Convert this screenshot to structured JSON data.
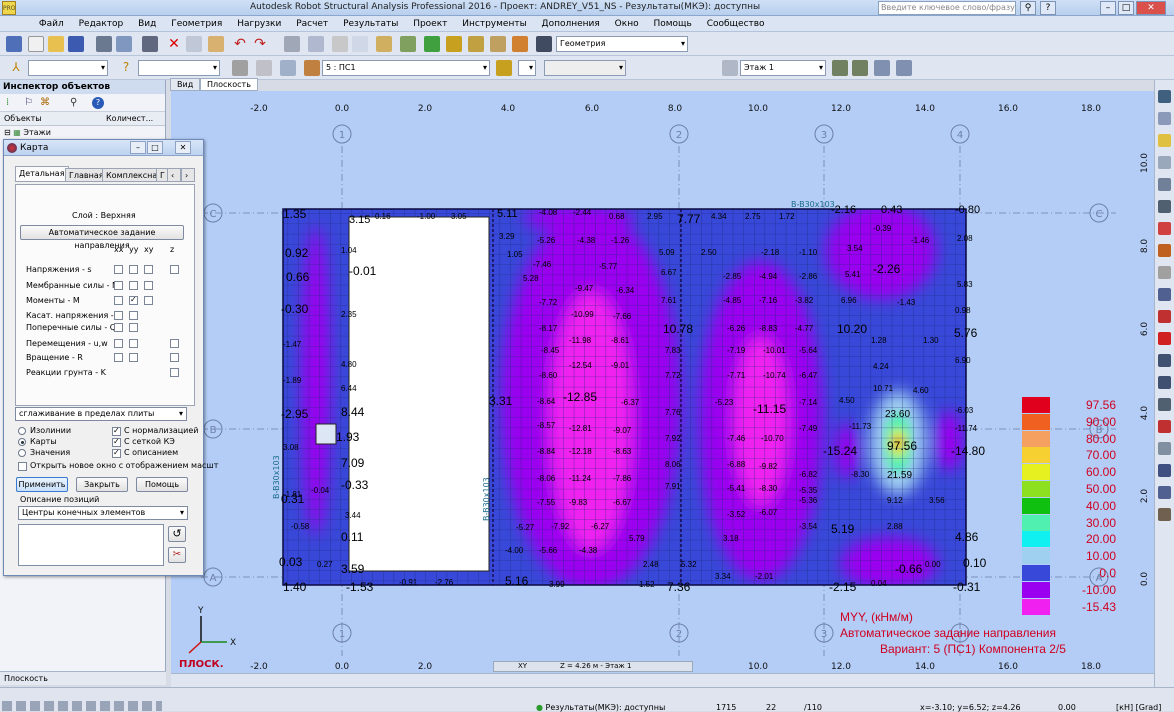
{
  "window": {
    "title": "Autodesk Robot Structural Analysis Professional 2016 - Проект: ANDREY_V51_NS - Результаты(МКЭ): доступны",
    "app_badge": "PRO",
    "search_placeholder": "Введите ключевое слово/фразу"
  },
  "menu": [
    "Файл",
    "Редактор",
    "Вид",
    "Геометрия",
    "Нагрузки",
    "Расчет",
    "Результаты",
    "Проект",
    "Инструменты",
    "Дополнения",
    "Окно",
    "Помощь",
    "Сообщество"
  ],
  "toolbar": {
    "layout_combo": "Геометрия",
    "case_combo": "5 : ПС1",
    "storey_combo": "Этаж 1"
  },
  "inspector": {
    "title": "Инспектор объектов",
    "col_objects": "Объекты",
    "col_count": "Количест...",
    "tree_item": "Этажи",
    "bottom_tab": "Плоскость"
  },
  "view_tabs": [
    "Вид",
    "Плоскость"
  ],
  "dialog": {
    "title": "Карта",
    "tabs": [
      "Детальная",
      "Главная",
      "Комплексная",
      "Г"
    ],
    "layer": "Слой : Верхняя",
    "auto_btn": "Автоматическое задание направления",
    "col_heads": [
      "xx",
      "yy",
      "xy",
      "z"
    ],
    "rows": [
      "Напряжения - s",
      "Мембранные силы - N",
      "Моменты - M",
      "Касат. напряжения - t",
      "Поперечные силы - Q",
      "Перемещения - u,w",
      "Вращение - R",
      "Реакции грунта - K"
    ],
    "smooth": "сглаживание в пределах плиты",
    "opt_isolines": "Изолинии",
    "opt_maps": "Карты",
    "opt_values": "Значения",
    "chk_norm": "С нормализацией",
    "chk_grid": "С сеткой КЭ",
    "chk_desc": "С описанием",
    "chk_newwin": "Открыть новое окно с отображением масшт",
    "btn_apply": "Применить",
    "btn_close": "Закрыть",
    "btn_help": "Помощь",
    "pos_label": "Описание позиций",
    "pos_select": "Центры конечных элементов"
  },
  "legend": {
    "values": [
      "97.56",
      "90.00",
      "80.00",
      "70.00",
      "60.00",
      "50.00",
      "40.00",
      "30.00",
      "20.00",
      "10.00",
      "0.0",
      "-10.00",
      "-15.43"
    ],
    "colors": [
      "#e0001e",
      "#f06020",
      "#f5a060",
      "#f5d030",
      "#e6f020",
      "#8ce020",
      "#10c010",
      "#50f0b0",
      "#10f0f0",
      "#a0d0f0",
      "#3848d8",
      "#9a00ef",
      "#f020f0"
    ]
  },
  "caption": {
    "line1": "MYY, (кНм/м)",
    "line2": "Автоматическое задание направления",
    "line3": "Вариант: 5 (ПС1) Компонента 2/5"
  },
  "axes": {
    "top": [
      "-2.0",
      "0.0",
      "2.0",
      "4.0",
      "6.0",
      "8.0",
      "10.0",
      "12.0",
      "14.0",
      "16.0",
      "18.0"
    ],
    "right": [
      "10.0",
      "8.0",
      "6.0",
      "4.0",
      "2.0",
      "0.0"
    ],
    "grid_cols": [
      "1",
      "2",
      "3",
      "4"
    ],
    "grid_rows": [
      "C",
      "B",
      "A"
    ],
    "view_label": "ПЛОСК.",
    "xy_label": "XY",
    "z_label": "Z = 4.26 м - Этаж 1"
  },
  "values": [
    {
      "t": "1.35"
    },
    {
      "t": "3.15"
    },
    {
      "t": "0.16"
    },
    {
      "t": "-1.00"
    },
    {
      "t": "3.05"
    },
    {
      "t": "5.11"
    },
    {
      "t": "-4.08"
    },
    {
      "t": "-2.44"
    },
    {
      "t": "0.68"
    },
    {
      "t": "2.95"
    },
    {
      "t": "7.77"
    },
    {
      "t": "4.34"
    },
    {
      "t": "2.75"
    },
    {
      "t": "1.72"
    },
    {
      "t": "-2.16"
    },
    {
      "t": "0.43"
    },
    {
      "t": "-0.80"
    },
    {
      "t": "0.92"
    },
    {
      "t": "1.04"
    },
    {
      "t": "3.29"
    },
    {
      "t": "-5.26"
    },
    {
      "t": "-4.38"
    },
    {
      "t": "-1.26"
    },
    {
      "t": "5.09"
    },
    {
      "t": "2.50"
    },
    {
      "t": "-2.18"
    },
    {
      "t": "-1.10"
    },
    {
      "t": "3.54"
    },
    {
      "t": "-0.39"
    },
    {
      "t": "-1.46"
    },
    {
      "t": "2.08"
    },
    {
      "t": "-0.01"
    },
    {
      "t": "0.66"
    },
    {
      "t": "-7.46"
    },
    {
      "t": "-5.77"
    },
    {
      "t": "-2.26"
    },
    {
      "t": "1.05"
    },
    {
      "t": "5.28"
    },
    {
      "t": "6.67"
    },
    {
      "t": "-2.85"
    },
    {
      "t": "-4.94"
    },
    {
      "t": "-2.86"
    },
    {
      "t": "5.41"
    },
    {
      "t": "5.83"
    },
    {
      "t": "-0.30"
    },
    {
      "t": "-9.47"
    },
    {
      "t": "-6.34"
    },
    {
      "t": "-7.72"
    },
    {
      "t": "7.61"
    },
    {
      "t": "-4.85"
    },
    {
      "t": "-7.16"
    },
    {
      "t": "-3.82"
    },
    {
      "t": "6.96"
    },
    {
      "t": "-1.43"
    },
    {
      "t": "0.98"
    },
    {
      "t": "2.35"
    },
    {
      "t": "-10.99"
    },
    {
      "t": "-7.66"
    },
    {
      "t": "-8.17"
    },
    {
      "t": "10.78"
    },
    {
      "t": "-6.26"
    },
    {
      "t": "-8.83"
    },
    {
      "t": "-4.77"
    },
    {
      "t": "10.20"
    },
    {
      "t": "5.76"
    },
    {
      "t": "-1.47"
    },
    {
      "t": "-11.98"
    },
    {
      "t": "-8.61"
    },
    {
      "t": "-8.45"
    },
    {
      "t": "7.83"
    },
    {
      "t": "-7.19"
    },
    {
      "t": "-10.01"
    },
    {
      "t": "-5.64"
    },
    {
      "t": "1.28"
    },
    {
      "t": "1.30"
    },
    {
      "t": "4.80"
    },
    {
      "t": "-1.89"
    },
    {
      "t": "-12.54"
    },
    {
      "t": "-9.01"
    },
    {
      "t": "-8.60"
    },
    {
      "t": "7.72"
    },
    {
      "t": "-7.71"
    },
    {
      "t": "-10.74"
    },
    {
      "t": "-6.47"
    },
    {
      "t": "4.24"
    },
    {
      "t": "6.90"
    },
    {
      "t": "6.44"
    },
    {
      "t": "-12.85"
    },
    {
      "t": "-8.64"
    },
    {
      "t": "-6.37"
    },
    {
      "t": "7.76"
    },
    {
      "t": "-5.23"
    },
    {
      "t": "-11.15"
    },
    {
      "t": "-7.14"
    },
    {
      "t": "4.50"
    },
    {
      "t": "10.71"
    },
    {
      "t": "4.60"
    },
    {
      "t": "-2.95"
    },
    {
      "t": "8.44"
    },
    {
      "t": "3.31"
    },
    {
      "t": "23.60"
    },
    {
      "t": "-6.03"
    },
    {
      "t": "1.93"
    },
    {
      "t": "-8.57"
    },
    {
      "t": "-12.81"
    },
    {
      "t": "-9.07"
    },
    {
      "t": "7.92"
    },
    {
      "t": "-7.46"
    },
    {
      "t": "-10.70"
    },
    {
      "t": "-7.49"
    },
    {
      "t": "-11.73"
    },
    {
      "t": "-11.74"
    },
    {
      "t": "3.08"
    },
    {
      "t": "-8.84"
    },
    {
      "t": "-12.18"
    },
    {
      "t": "-8.63"
    },
    {
      "t": "-15.24"
    },
    {
      "t": "97.56"
    },
    {
      "t": "-14.80"
    },
    {
      "t": "7.09"
    },
    {
      "t": "8.06"
    },
    {
      "t": "-6.88"
    },
    {
      "t": "-9.82"
    },
    {
      "t": "-6.82"
    },
    {
      "t": "-8.30"
    },
    {
      "t": "21.59"
    },
    {
      "t": "-0.33"
    },
    {
      "t": "-1.81"
    },
    {
      "t": "-8.06"
    },
    {
      "t": "-11.24"
    },
    {
      "t": "-7.86"
    },
    {
      "t": "7.91"
    },
    {
      "t": "-5.41"
    },
    {
      "t": "-8.30"
    },
    {
      "t": "-5.35"
    },
    {
      "t": "-0.04"
    },
    {
      "t": "0.31"
    },
    {
      "t": "-7.55"
    },
    {
      "t": "-9.83"
    },
    {
      "t": "-6.67"
    },
    {
      "t": "-3.52"
    },
    {
      "t": "-6.07"
    },
    {
      "t": "-5.36"
    },
    {
      "t": "9.12"
    },
    {
      "t": "3.56"
    },
    {
      "t": "3.44"
    },
    {
      "t": "-5.27"
    },
    {
      "t": "-7.92"
    },
    {
      "t": "-6.27"
    },
    {
      "t": "-3.54"
    },
    {
      "t": "2.88"
    },
    {
      "t": "5.19"
    },
    {
      "t": "-0.58"
    },
    {
      "t": "0.11"
    },
    {
      "t": "-4.00"
    },
    {
      "t": "-5.66"
    },
    {
      "t": "-4.38"
    },
    {
      "t": "5.79"
    },
    {
      "t": "3.18"
    },
    {
      "t": "4.86"
    },
    {
      "t": "0.03"
    },
    {
      "t": "0.27"
    },
    {
      "t": "3.59"
    },
    {
      "t": "2.48"
    },
    {
      "t": "5.32"
    },
    {
      "t": "3.34"
    },
    {
      "t": "-2.01"
    },
    {
      "t": "-0.66"
    },
    {
      "t": "0.00"
    },
    {
      "t": "0.10"
    },
    {
      "t": "1.40"
    },
    {
      "t": "-1.53"
    },
    {
      "t": "-0.91"
    },
    {
      "t": "-2.76"
    },
    {
      "t": "5.16"
    },
    {
      "t": "3.99"
    },
    {
      "t": "1.52"
    },
    {
      "t": "7.36"
    },
    {
      "t": "-2.15"
    },
    {
      "t": "0.04"
    },
    {
      "t": "-0.31"
    }
  ],
  "beams": [
    "B-B30x103",
    "B-B30x103",
    "B-B30x103"
  ],
  "status": {
    "text": "Результаты(МКЭ): доступны",
    "n1": "1715",
    "n2": "22",
    "n3": "/110",
    "coords": "x=-3.10; y=6.52; z=4.26",
    "n4": "0.00",
    "units": "[кН] [Grad]"
  }
}
